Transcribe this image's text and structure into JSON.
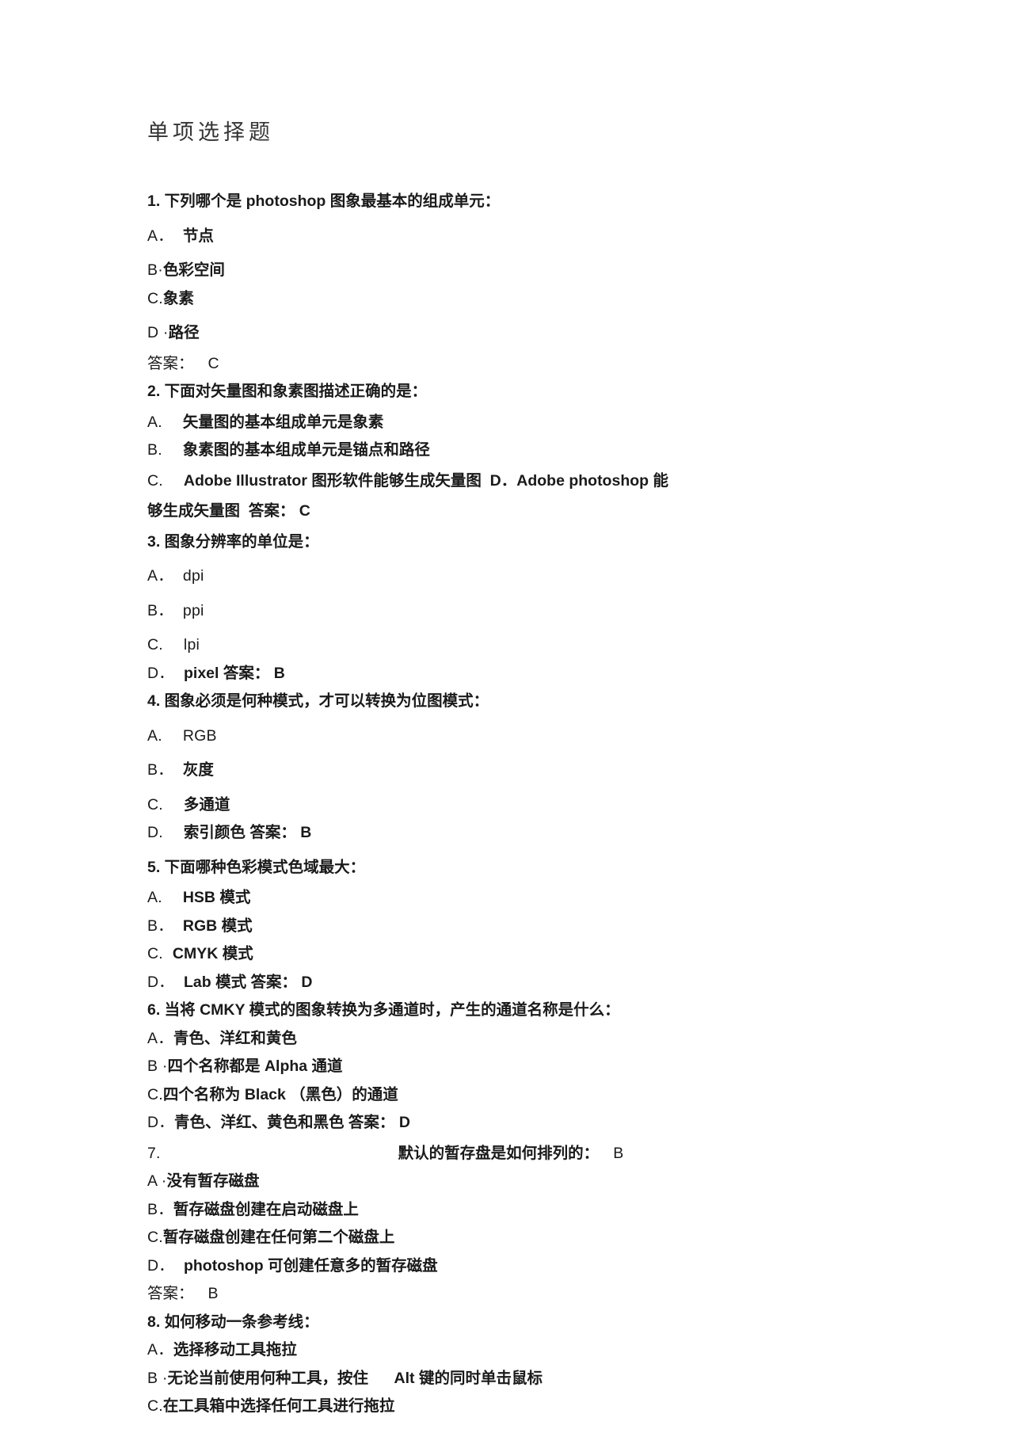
{
  "document": {
    "title": "单项选择题",
    "type": "multiple-choice-exam",
    "subject": "photoshop"
  },
  "questions": [
    {
      "number": "1.",
      "stem_pre": "下列哪个是",
      "stem_latin": "photoshop",
      "stem_a": "图",
      "stem_b": "象最基本的",
      "stem_c": "组",
      "stem_d": "成",
      "stem_e": "单",
      "stem_f": "元：",
      "full_stem": "1. 下列哪个是 photoshop 图象最基本的组成单元：",
      "options": [
        {
          "label": "A．",
          "text": "节点",
          "faint_part": "节",
          "bold_part": "点"
        },
        {
          "label": "B·",
          "text": "色彩空间",
          "bold_part": "色彩空",
          "faint_part": "间"
        },
        {
          "label": "C.",
          "text": "象素"
        },
        {
          "label": "D ·",
          "text": "路径"
        }
      ],
      "answer_label": "答案：",
      "answer": "C"
    },
    {
      "number": "2.",
      "full_stem": "2. 下面对矢量图和象素图描述正确的是：",
      "stem_1": "下面",
      "stem_2": "对",
      "stem_3": "矢量",
      "stem_4": "图",
      "stem_5": "和象素",
      "stem_6": "图",
      "stem_7": "描述正确的是：",
      "options": [
        {
          "label": "A.",
          "text": "矢量图的基本组成单元是象素"
        },
        {
          "label": "B.",
          "text": "象素图的基本组成单元是锚点和路径"
        },
        {
          "label": "C.",
          "text": "Adobe Illustrator 图形软件能够生成矢量图  D．Adobe photoshop 能"
        },
        {
          "label": "",
          "text": "够生成矢量图  答案： C"
        }
      ],
      "answer_label": "答案：",
      "answer": "C"
    },
    {
      "number": "3.",
      "full_stem": "3. 图象分辨率的单位是：",
      "options": [
        {
          "label": "A．",
          "text": "dpi"
        },
        {
          "label": "B．",
          "text": "ppi"
        },
        {
          "label": "C.",
          "text": "lpi"
        },
        {
          "label": "D．",
          "text": "pixel 答案： B"
        }
      ],
      "answer_label": "答案：",
      "answer": "B"
    },
    {
      "number": "4.",
      "full_stem": "4. 图象必须是何种模式，才可以转换为位图模式：",
      "options": [
        {
          "label": "A.",
          "text": "RGB"
        },
        {
          "label": "B．",
          "text": "灰度"
        },
        {
          "label": "C.",
          "text": "多通道"
        },
        {
          "label": "D.",
          "text": "索引颜色 答案： B"
        }
      ],
      "answer_label": "答案：",
      "answer": "B"
    },
    {
      "number": "5.",
      "full_stem": "5. 下面哪种色彩模式色域最大：",
      "options": [
        {
          "label": "A.",
          "text": "HSB 模式"
        },
        {
          "label": "B．",
          "text": "RGB 模式"
        },
        {
          "label": "C.",
          "text": "CMYK 模式"
        },
        {
          "label": "D．",
          "text": "Lab 模式 答案： D"
        }
      ],
      "answer_label": "答案：",
      "answer": "D"
    },
    {
      "number": "6.",
      "full_stem": "6. 当将 CMKY 模式的图象转换为多通道时，产生的通道名称是什么：",
      "options": [
        {
          "label": "A．",
          "text": "青色、洋红和黄色"
        },
        {
          "label": "B ·",
          "text": "四个名称都是 Alpha 通道"
        },
        {
          "label": "C.",
          "text": "四个名称为 Black （黑色）的通道"
        },
        {
          "label": "D．",
          "text": "青色、洋红、黄色和黑色 答案： D"
        }
      ],
      "answer_label": "答案：",
      "answer": "D"
    },
    {
      "number": "7.",
      "full_stem": "7.                                        默认的暂存盘是如何排列的： B",
      "stem_tail": "默认的暂存盘是如何排列的：",
      "inline_answer": "B",
      "options": [
        {
          "label": "A ·",
          "text": "没有暂存磁盘"
        },
        {
          "label": "B．",
          "text": "暂存磁盘创建在启动磁盘上"
        },
        {
          "label": "C.",
          "text": "暂存磁盘创建在任何第二个磁盘上"
        },
        {
          "label": "D．",
          "text": "photoshop 可创建任意多的暂存磁盘"
        }
      ],
      "answer_label": "答案：",
      "answer": "B"
    },
    {
      "number": "8.",
      "full_stem": "8. 如何移动一条参考线：",
      "options": [
        {
          "label": "A．",
          "text": "选择移动工具拖拉"
        },
        {
          "label": "B ·",
          "text": "无论当前使用何种工具，按住      Alt 键的同时单击鼠标"
        },
        {
          "label": "C.",
          "text": "在工具箱中选择任何工具进行拖拉"
        }
      ],
      "answer_label": "",
      "answer": ""
    }
  ],
  "labels": {
    "answer_prefix": "答案：",
    "q1_num": "1.",
    "q2_num": "2.",
    "q3_num": "3.",
    "q4_num": "4.",
    "q5_num": "5.",
    "q6_num": "6.",
    "q7_num": "7.",
    "q8_num": "8."
  },
  "colors": {
    "page_background": "#ffffff",
    "body_text": "#1a1a1a",
    "title_text": "#343434",
    "faded_text": "#8e8e8e"
  }
}
